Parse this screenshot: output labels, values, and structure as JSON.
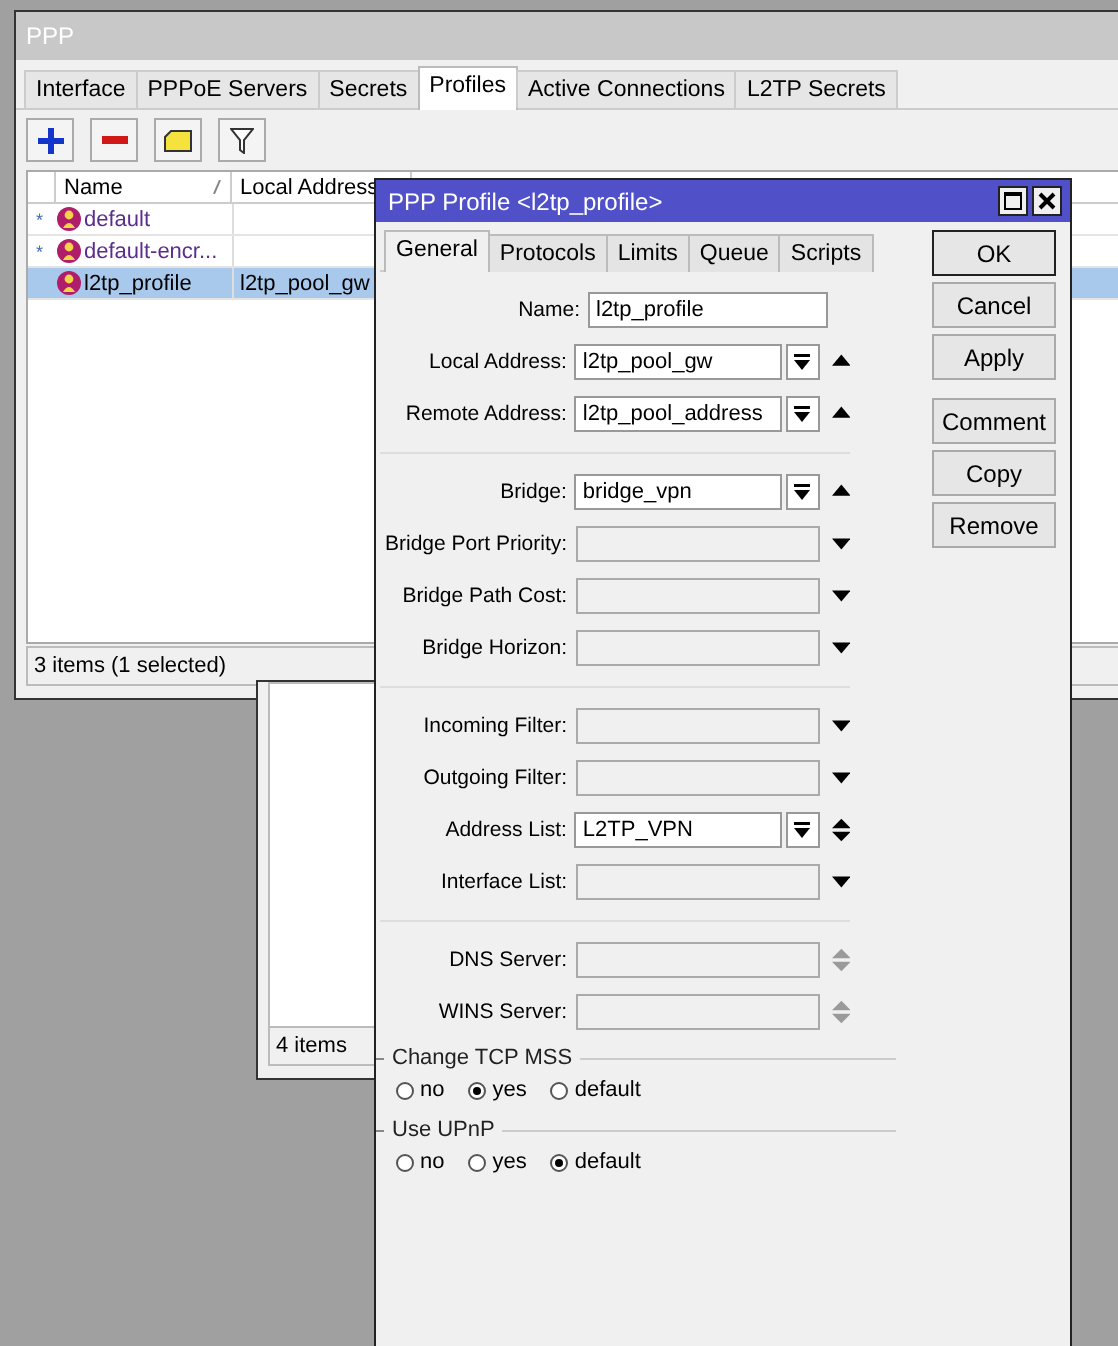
{
  "ppp_window": {
    "title": "PPP",
    "tabs": [
      {
        "label": "Interface",
        "selected": false
      },
      {
        "label": "PPPoE Servers",
        "selected": false
      },
      {
        "label": "Secrets",
        "selected": false
      },
      {
        "label": "Profiles",
        "selected": true
      },
      {
        "label": "Active Connections",
        "selected": false
      },
      {
        "label": "L2TP Secrets",
        "selected": false
      }
    ],
    "table": {
      "columns": [
        {
          "label": "Name"
        },
        {
          "label": "Local Address"
        }
      ],
      "rows": [
        {
          "marker": "*",
          "name": "default",
          "selected": false,
          "color": "#5b2d8c"
        },
        {
          "marker": "*",
          "name": "default-encr...",
          "selected": false,
          "color": "#5b2d8c"
        },
        {
          "name": "l2tp_profile",
          "local_address": "l2tp_pool_gw",
          "selected": true,
          "color": "#000000"
        }
      ]
    },
    "status_bar": "3 items (1 selected)"
  },
  "back_window": {
    "status_bar": "4 items"
  },
  "dialog": {
    "title": "PPP Profile <l2tp_profile>",
    "tabs": [
      {
        "label": "General",
        "selected": true
      },
      {
        "label": "Protocols",
        "selected": false
      },
      {
        "label": "Limits",
        "selected": false
      },
      {
        "label": "Queue",
        "selected": false
      },
      {
        "label": "Scripts",
        "selected": false
      }
    ],
    "sections": [
      {
        "fields": [
          {
            "label": "Name:",
            "value": "l2tp_profile",
            "kind": "text"
          },
          {
            "label": "Local Address:",
            "value": "l2tp_pool_gw",
            "kind": "combo",
            "arrow": {
              "kind": "up",
              "disabled": false
            }
          },
          {
            "label": "Remote Address:",
            "value": "l2tp_pool_address",
            "kind": "combo",
            "arrow": {
              "kind": "up",
              "disabled": false
            }
          }
        ]
      },
      {
        "fields": [
          {
            "label": "Bridge:",
            "value": "bridge_vpn",
            "kind": "combo",
            "arrow": {
              "kind": "up",
              "disabled": false
            }
          },
          {
            "label": "Bridge Port Priority:",
            "kind": "select",
            "arrow": {
              "kind": "down",
              "disabled": false
            }
          },
          {
            "label": "Bridge Path Cost:",
            "kind": "select",
            "arrow": {
              "kind": "down",
              "disabled": false
            }
          },
          {
            "label": "Bridge Horizon:",
            "kind": "select",
            "arrow": {
              "kind": "down",
              "disabled": false
            }
          }
        ]
      },
      {
        "fields": [
          {
            "label": "Incoming Filter:",
            "kind": "select",
            "arrow": {
              "kind": "down",
              "disabled": false
            }
          },
          {
            "label": "Outgoing Filter:",
            "kind": "select",
            "arrow": {
              "kind": "down",
              "disabled": false
            }
          },
          {
            "label": "Address List:",
            "value": "L2TP_VPN",
            "kind": "combo",
            "arrow": {
              "kind": "updown",
              "disabled": false
            }
          },
          {
            "label": "Interface List:",
            "kind": "select",
            "arrow": {
              "kind": "down",
              "disabled": false
            }
          }
        ]
      },
      {
        "fields": [
          {
            "label": "DNS Server:",
            "kind": "select",
            "arrow": {
              "kind": "updown",
              "disabled": true
            }
          },
          {
            "label": "WINS Server:",
            "kind": "select",
            "arrow": {
              "kind": "updown",
              "disabled": true
            }
          }
        ]
      }
    ],
    "radio_groups": [
      {
        "title": "Change TCP MSS",
        "options": [
          {
            "label": "no",
            "selected": false
          },
          {
            "label": "yes",
            "selected": true
          },
          {
            "label": "default",
            "selected": false
          }
        ]
      },
      {
        "title": "Use UPnP",
        "options": [
          {
            "label": "no",
            "selected": false
          },
          {
            "label": "yes",
            "selected": false
          },
          {
            "label": "default",
            "selected": true
          }
        ]
      }
    ],
    "buttons": [
      {
        "label": "OK",
        "default": true
      },
      {
        "label": "Cancel",
        "default": false
      },
      {
        "label": "Apply",
        "default": false
      },
      {
        "label": "Comment",
        "default": false
      },
      {
        "label": "Copy",
        "default": false
      },
      {
        "label": "Remove",
        "default": false
      }
    ]
  }
}
